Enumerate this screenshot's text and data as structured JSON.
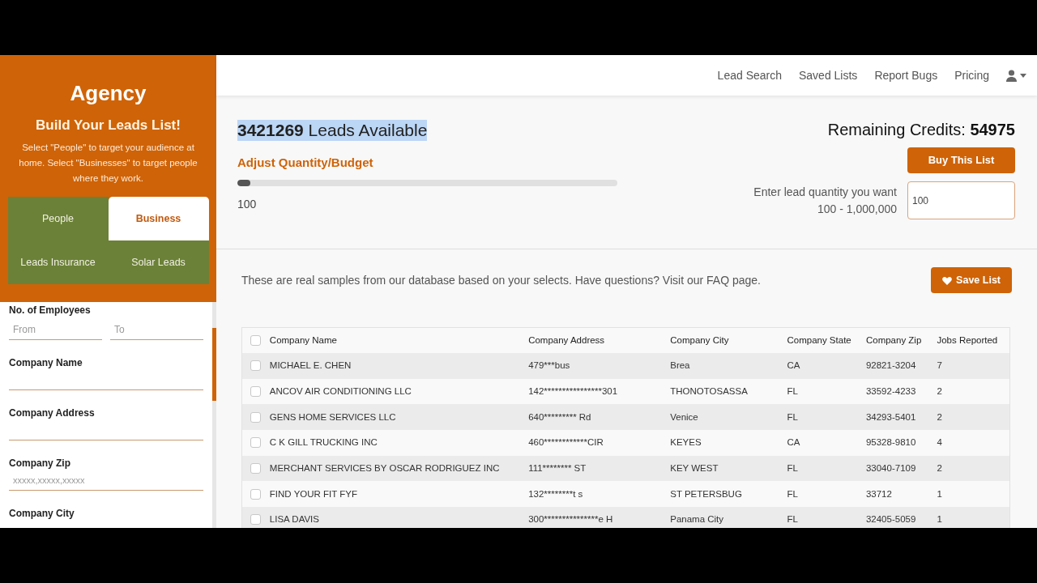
{
  "sidebar": {
    "brand": "Agency",
    "heading": "Build Your Leads List!",
    "description": "Select \"People\" to target your audience at home. Select \"Businesses\" to target people where they work.",
    "types": [
      {
        "label": "People",
        "selected": false
      },
      {
        "label": "Business",
        "selected": true
      },
      {
        "label": "Leads Insurance",
        "selected": false
      },
      {
        "label": "Solar Leads",
        "selected": false
      }
    ],
    "filters": [
      {
        "kind": "range",
        "label": "No. of Employees",
        "from_placeholder": "From",
        "to_placeholder": "To"
      },
      {
        "kind": "text",
        "label": "Company Name"
      },
      {
        "kind": "text",
        "label": "Company Address"
      },
      {
        "kind": "text",
        "label": "Company Zip",
        "placeholder": "xxxxx,xxxxx,xxxxx"
      },
      {
        "kind": "label",
        "label": "Company City"
      }
    ]
  },
  "nav": {
    "links": [
      "Lead Search",
      "Saved Lists",
      "Report Bugs",
      "Pricing"
    ]
  },
  "summary": {
    "count": "3421269",
    "count_suffix": "Leads Available",
    "highlighted": true,
    "adjust_label": "Adjust Quantity/Budget",
    "slider": {
      "level": 0.035
    },
    "slider_value": "100",
    "credits_label": "Remaining Credits:",
    "credits": "54975",
    "buy_button": "Buy This List",
    "quantity_label": "Enter lead quantity you want 100 - 1,000,000",
    "quantity_value": "100"
  },
  "samples": {
    "note": "These are real samples from our database based on your selects. Have questions? Visit our FAQ page.",
    "save_button": "Save List"
  },
  "table": {
    "header_checked": false,
    "columns": [
      "Company Name",
      "Company Address",
      "Company City",
      "Company State",
      "Company Zip",
      "Jobs Reported"
    ],
    "rows": [
      {
        "checked": false,
        "cells": [
          "MICHAEL E. CHEN",
          "479***bus",
          "Brea",
          "CA",
          "92821-3204",
          "7"
        ]
      },
      {
        "checked": false,
        "cells": [
          "ANCOV AIR CONDITIONING LLC",
          "142****************301",
          "THONOTOSASSA",
          "FL",
          "33592-4233",
          "2"
        ]
      },
      {
        "checked": false,
        "cells": [
          "GENS HOME SERVICES LLC",
          "640********* Rd",
          "Venice",
          "FL",
          "34293-5401",
          "2"
        ]
      },
      {
        "checked": false,
        "cells": [
          "C K GILL TRUCKING INC",
          "460************CIR",
          "KEYES",
          "CA",
          "95328-9810",
          "4"
        ]
      },
      {
        "checked": false,
        "cells": [
          "MERCHANT SERVICES BY OSCAR RODRIGUEZ INC",
          "111******** ST",
          "KEY WEST",
          "FL",
          "33040-7109",
          "2"
        ]
      },
      {
        "checked": false,
        "cells": [
          "FIND YOUR FIT FYF",
          "132********t s",
          "ST PETERSBUG",
          "FL",
          "33712",
          "1"
        ]
      },
      {
        "checked": false,
        "cells": [
          "LISA DAVIS",
          "300***************e H",
          "Panama City",
          "FL",
          "32405-5059",
          "1"
        ]
      }
    ]
  }
}
